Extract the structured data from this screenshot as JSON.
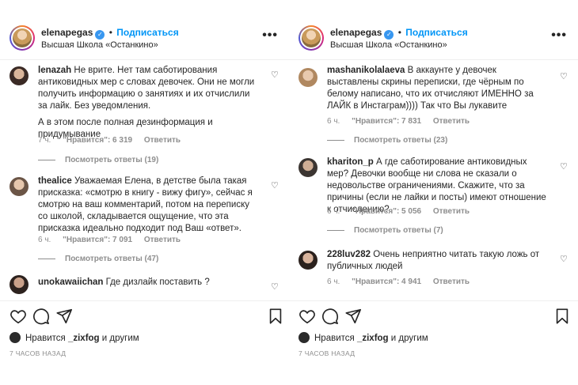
{
  "header": {
    "username": "elenapegas",
    "verified_mark": "✓",
    "dot": "•",
    "follow_label": "Подписаться",
    "location": "Высшая Школа «Останкино»",
    "more_label": "•••"
  },
  "left": {
    "comments": [
      {
        "username": "lenazah",
        "text": "Не врите. Нет там саботирования антиковидных мер с словах девочек. Они не могли получить информацию о занятиях и их отчислили за лайк. Без уведомления.",
        "text2": "А в этом после полная дезинформация и придумывание",
        "time": "7 ч.",
        "likes": "\"Нравится\": 6 319",
        "reply": "Ответить",
        "view_replies": "Посмотреть ответы (19)"
      },
      {
        "username": "thealice",
        "text": "Уважаемая Елена, в детстве была такая присказка: «смотрю в книгу - вижу фигу», сейчас я смотрю на ваш комментарий, потом на переписку со школой, складывается ощущение, что эта присказка идеально подходит под Ваш «ответ».",
        "time": "6 ч.",
        "likes": "\"Нравится\": 7 091",
        "reply": "Ответить",
        "view_replies": "Посмотреть ответы (47)"
      },
      {
        "username": "unokawaiichan",
        "text": "Где дизлайк поставить ?"
      }
    ]
  },
  "right": {
    "comments": [
      {
        "username": "mashanikolalaeva",
        "text": "В аккаунте у девочек выставлены скрины переписки, где чёрным по белому написано, что их отчисляют ИМЕННО за ЛАЙК в Инстаграм)))) Так что Вы лукавите",
        "time": "6 ч.",
        "likes": "\"Нравится\": 7 831",
        "reply": "Ответить",
        "view_replies": "Посмотреть ответы (23)"
      },
      {
        "username": "khariton_p",
        "text": "А где саботирование антиковидных мер? Девочки вообще ни слова не сказали о недовольстве ограничениями. Скажите, что за причины (если не лайки и посты) имеют отношение к отчислению?",
        "time": "6 ч.",
        "likes": "\"Нравится\": 5 056",
        "reply": "Ответить",
        "view_replies": "Посмотреть ответы (7)"
      },
      {
        "username": "228luv282",
        "text": "Очень неприятно читать такую ложь от публичных людей",
        "time": "6 ч.",
        "likes": "\"Нравится\": 4 941",
        "reply": "Ответить"
      }
    ]
  },
  "footer": {
    "likes_prefix": "Нравится",
    "likes_user": "_zixfog",
    "likes_suffix": "и другим",
    "time_ago": "7 ЧАСОВ НАЗАД"
  },
  "icons": {
    "heart": "heart-icon",
    "comment": "comment-icon",
    "share": "paper-plane-icon",
    "save": "bookmark-icon"
  }
}
